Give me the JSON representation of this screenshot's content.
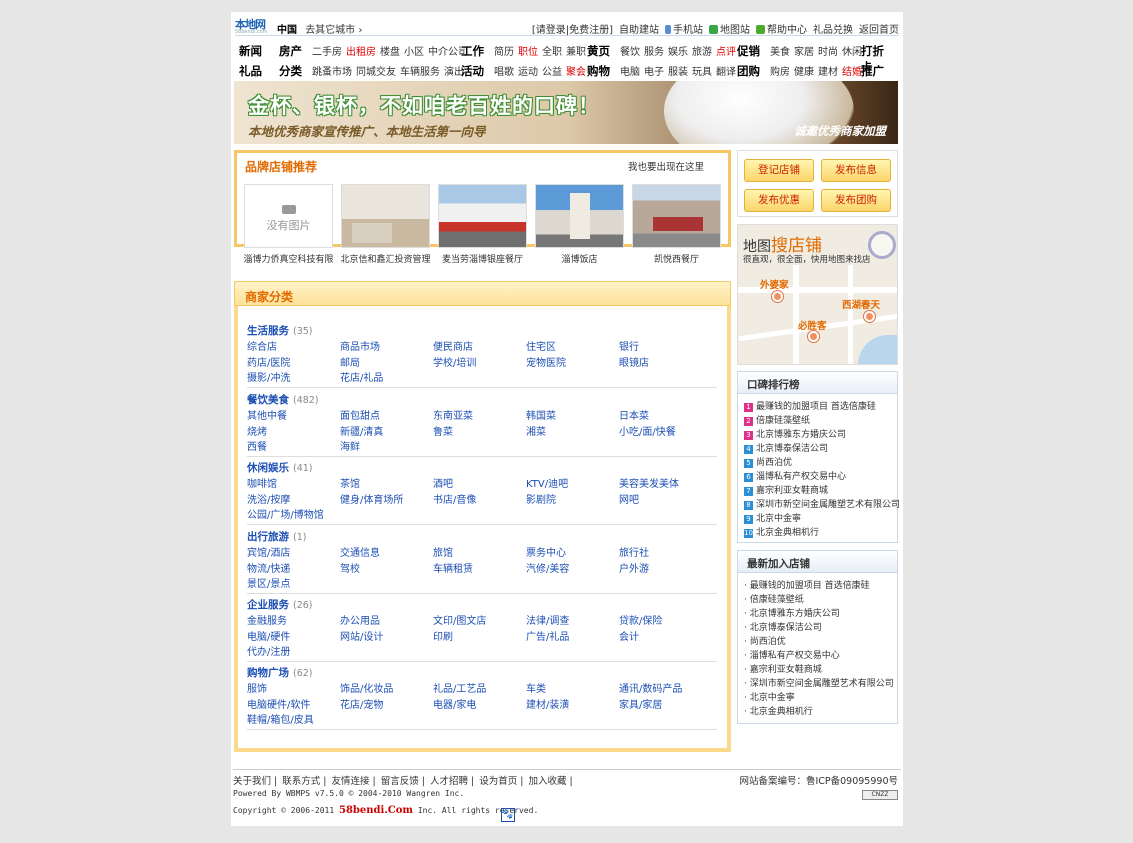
{
  "header": {
    "logo_text": "本地网",
    "logo_sub": "58bendi.com",
    "region": "中国",
    "region_switch": "去其它城市",
    "links": [
      "[请登录",
      "|免费注册]",
      "自助建站",
      "手机站",
      "地图站",
      "帮助中心",
      "礼品兑换",
      "返回首页"
    ]
  },
  "nav": {
    "rows": [
      [
        {
          "main": "新闻",
          "subs": []
        },
        {
          "main": "房产",
          "subs": [
            {
              "t": "二手房"
            },
            {
              "t": "出租房",
              "hl": true
            },
            {
              "t": "楼盘"
            },
            {
              "t": "小区"
            },
            {
              "t": "中介公司"
            }
          ]
        },
        {
          "main": "工作",
          "subs": [
            {
              "t": "简历"
            },
            {
              "t": "职位",
              "hl": true
            },
            {
              "t": "全职"
            },
            {
              "t": "兼职"
            }
          ]
        },
        {
          "main": "黄页",
          "subs": [
            {
              "t": "餐饮"
            },
            {
              "t": "服务"
            },
            {
              "t": "娱乐"
            },
            {
              "t": "旅游"
            },
            {
              "t": "点评",
              "hl": true
            }
          ]
        },
        {
          "main": "促销",
          "subs": [
            {
              "t": "美食"
            },
            {
              "t": "家居"
            },
            {
              "t": "时尚"
            },
            {
              "t": "休闲"
            }
          ]
        },
        {
          "main": "打折卡",
          "subs": []
        }
      ],
      [
        {
          "main": "礼品",
          "subs": []
        },
        {
          "main": "分类",
          "subs": [
            {
              "t": "跳蚤市场"
            },
            {
              "t": "同城交友"
            },
            {
              "t": "车辆服务"
            },
            {
              "t": "演出"
            }
          ]
        },
        {
          "main": "活动",
          "subs": [
            {
              "t": "唱歌"
            },
            {
              "t": "运动"
            },
            {
              "t": "公益"
            },
            {
              "t": "聚会",
              "hl": true
            }
          ]
        },
        {
          "main": "购物",
          "subs": [
            {
              "t": "电脑"
            },
            {
              "t": "电子"
            },
            {
              "t": "服装"
            },
            {
              "t": "玩具"
            },
            {
              "t": "翻译"
            }
          ]
        },
        {
          "main": "团购",
          "subs": [
            {
              "t": "购房"
            },
            {
              "t": "健康"
            },
            {
              "t": "建材"
            },
            {
              "t": "结婚",
              "hl": true
            }
          ]
        },
        {
          "main": "推广易",
          "subs": []
        }
      ]
    ]
  },
  "banner": {
    "headline": "金杯、银杯，不如咱老百姓的口碑！",
    "sub": "本地优秀商家宣传推广、本地生活第一向导",
    "invite": "诚邀优秀商家加盟"
  },
  "brand": {
    "title": "品牌店铺推荐",
    "more": "我也要出现在这里",
    "no_image": "没有图片",
    "shops": [
      "淄博力侨真空科技有限",
      "北京信和鑫汇投资管理",
      "麦当劳淄博银座餐厅",
      "淄博饭店",
      "凯悦西餐厅"
    ]
  },
  "categories": {
    "title": "商家分类",
    "groups": [
      {
        "name": "生活服务",
        "count": "(35)",
        "items": [
          "综合店",
          "商品市场",
          "便民商店",
          "住宅区",
          "银行",
          "药店/医院",
          "邮局",
          "学校/培训",
          "宠物医院",
          "眼镜店",
          "摄影/冲洗",
          "花店/礼品"
        ]
      },
      {
        "name": "餐饮美食",
        "count": "(482)",
        "items": [
          "其他中餐",
          "面包甜点",
          "东南亚菜",
          "韩国菜",
          "日本菜",
          "烧烤",
          "新疆/清真",
          "鲁菜",
          "湘菜",
          "小吃/面/快餐",
          "西餐",
          "海鲜"
        ]
      },
      {
        "name": "休闲娱乐",
        "count": "(41)",
        "items": [
          "咖啡馆",
          "茶馆",
          "酒吧",
          "KTV/迪吧",
          "美容美发美体",
          "洗浴/按摩",
          "健身/体育场所",
          "书店/音像",
          "影剧院",
          "网吧",
          "公园/广场/博物馆"
        ]
      },
      {
        "name": "出行旅游",
        "count": "(1)",
        "items": [
          "宾馆/酒店",
          "交通信息",
          "旅馆",
          "票务中心",
          "旅行社",
          "物流/快递",
          "驾校",
          "车辆租赁",
          "汽修/美容",
          "户外游",
          "景区/景点"
        ]
      },
      {
        "name": "企业服务",
        "count": "(26)",
        "items": [
          "金融服务",
          "办公用品",
          "文印/图文店",
          "法律/调查",
          "贷款/保险",
          "电脑/硬件",
          "网站/设计",
          "印刷",
          "广告/礼品",
          "会计",
          "代办/注册"
        ]
      },
      {
        "name": "购物广场",
        "count": "(62)",
        "items": [
          "服饰",
          "饰品/化妆品",
          "礼品/工艺品",
          "车类",
          "通讯/数码产品",
          "电脑硬件/软件",
          "花店/宠物",
          "电器/家电",
          "建材/装潢",
          "家具/家居",
          "鞋帽/箱包/皮具"
        ]
      }
    ]
  },
  "actions": [
    "登记店铺",
    "发布信息",
    "发布优惠",
    "发布团购"
  ],
  "map": {
    "title_a": "地图",
    "title_b": "搜店铺",
    "sub": "很直观，很全面，快用地图来找店",
    "pins": [
      "外婆家",
      "西湖春天",
      "必胜客"
    ]
  },
  "ranking": {
    "title": "口碑排行榜",
    "items": [
      "最赚钱的加盟项目 首选倍康硅",
      "倍康硅藻壁纸",
      "北京博雅东方婚庆公司",
      "北京博泰保洁公司",
      "尚西泊优",
      "淄博私有产权交易中心",
      "嘉宗利亚女鞋商城",
      "深圳市新空间金属雕塑艺术有限公司",
      "北京中金寧",
      "北京金典相机行"
    ],
    "colors": [
      "#e0308a",
      "#e0308a",
      "#e0308a",
      "#2a8fd6",
      "#2a8fd6",
      "#2a8fd6",
      "#2a8fd6",
      "#2a8fd6",
      "#2a8fd6",
      "#2a8fd6"
    ]
  },
  "newest": {
    "title": "最新加入店铺",
    "items": [
      "最赚钱的加盟项目 首选倍康硅",
      "倍康硅藻壁纸",
      "北京博雅东方婚庆公司",
      "北京博泰保洁公司",
      "尚西泊优",
      "淄博私有产权交易中心",
      "嘉宗利亚女鞋商城",
      "深圳市新空间金属雕塑艺术有限公司",
      "北京中金寧",
      "北京金典相机行"
    ]
  },
  "footer": {
    "links": [
      "关于我们",
      "联系方式",
      "友情连接",
      "留言反馈",
      "人才招聘",
      "设为首页",
      "加入收藏"
    ],
    "icp": "网站备案编号：鲁ICP备09095990号",
    "powered": "Powered By WBMPS v7.5.0 © 2004-2010 Wangren Inc.",
    "copy_a": "Copyright © 2006-2011",
    "copy_brand": "58bendi.Com",
    "copy_b": "Inc. All rights reserved.",
    "cnzz": "CNZZ"
  }
}
